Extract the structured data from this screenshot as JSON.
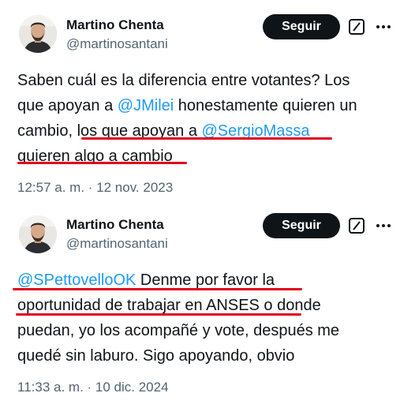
{
  "tweets": [
    {
      "author_name": "Martino Chenta",
      "author_handle": "@martinosantani",
      "follow_label": "Seguir",
      "text_parts": {
        "l1": "Saben cuál es la diferencia entre votantes? Los",
        "l2a": "que apoyan a ",
        "l2b": "@JMilei",
        "l2c": " honestamente quieren un",
        "l3a": "cambio, ",
        "l3b": "los que apoyan a ",
        "l3c": "@SergioMassa",
        "l4": "quieren algo a cambio"
      },
      "timestamp": "12:57 a. m. · 12 nov. 2023"
    },
    {
      "author_name": "Martino Chenta",
      "author_handle": "@martinosantani",
      "follow_label": "Seguir",
      "text_parts": {
        "l1a": "@SPettovelloOK",
        "l1b": " Denme por favor la",
        "l2a": "oportunidad de trabajar en ANSES",
        "l2b": " o donde",
        "l3": "puedan, yo los acompañé y vote, después me",
        "l4": "quedé sin laburo. Sigo apoyando, obvio"
      },
      "timestamp": "11:33 a. m. · 10 dic. 2024"
    }
  ],
  "icons": {
    "grok": "grok-icon",
    "more": "more-icon"
  },
  "colors": {
    "mention": "#1d9bf0",
    "follow_bg": "#0f1419",
    "annotation": "#e3001b",
    "secondary_text": "#536471"
  }
}
